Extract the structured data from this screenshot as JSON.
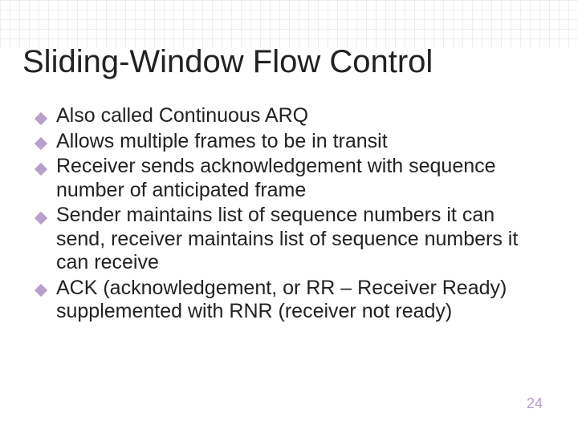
{
  "title": "Sliding-Window Flow Control",
  "bullets": {
    "b0": "Also called Continuous ARQ",
    "b1": "Allows multiple frames to be in transit",
    "b2": "Receiver sends acknowledgement with sequence number of anticipated frame",
    "b3": "Sender maintains list of sequence numbers it can send, receiver maintains list of sequence numbers it can receive",
    "b4": "ACK (acknowledgement, or RR – Receiver Ready) supplemented with RNR (receiver not ready)"
  },
  "page_number": "24"
}
